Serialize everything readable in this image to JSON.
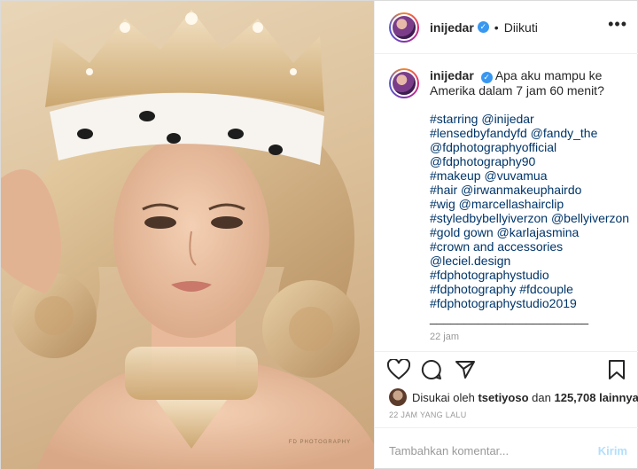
{
  "account": {
    "username": "inijedar",
    "verified_glyph": "✓",
    "separator": "•",
    "follow_status": "Diikuti"
  },
  "header": {
    "more_glyph": "•••"
  },
  "photo": {
    "watermark": "FD PHOTOGRAPHY",
    "description_icon": "queen-portrait-photo"
  },
  "caption": {
    "text": "Apa aku mampu ke Amerika dalam 7 jam 60 menit?",
    "lines": [
      "#starring @inijedar",
      "#lensedbyfandyfd @fandy_the",
      "@fdphotographyofficial",
      "@fdphotography90",
      "#makeup @vuvamua",
      "#hair @irwanmakeuphairdo",
      "#wig @marcellashairclip",
      "#styledbybellyiverzon @bellyiverzon",
      "#gold gown @karlajasmina",
      "#crown and accessories",
      "@leciel.design",
      "#fdphotographystudio",
      "#fdphotography #fdcouple",
      "#fdphotographystudio2019",
      "_______________________"
    ],
    "time": "22 jam"
  },
  "likes": {
    "prefix": "Disukai oleh",
    "user": "tsetiyoso",
    "joiner": "dan",
    "count": "125,708 lainnya"
  },
  "timestamp": "22 JAM YANG LALU",
  "comment": {
    "placeholder": "Tambahkan komentar...",
    "send": "Kirim"
  },
  "icons": {
    "like": "heart-icon",
    "comment": "comment-icon",
    "share": "share-icon",
    "save": "bookmark-icon"
  },
  "colors": {
    "link": "#003569",
    "verified": "#3897f0",
    "send": "#b2dffc"
  }
}
